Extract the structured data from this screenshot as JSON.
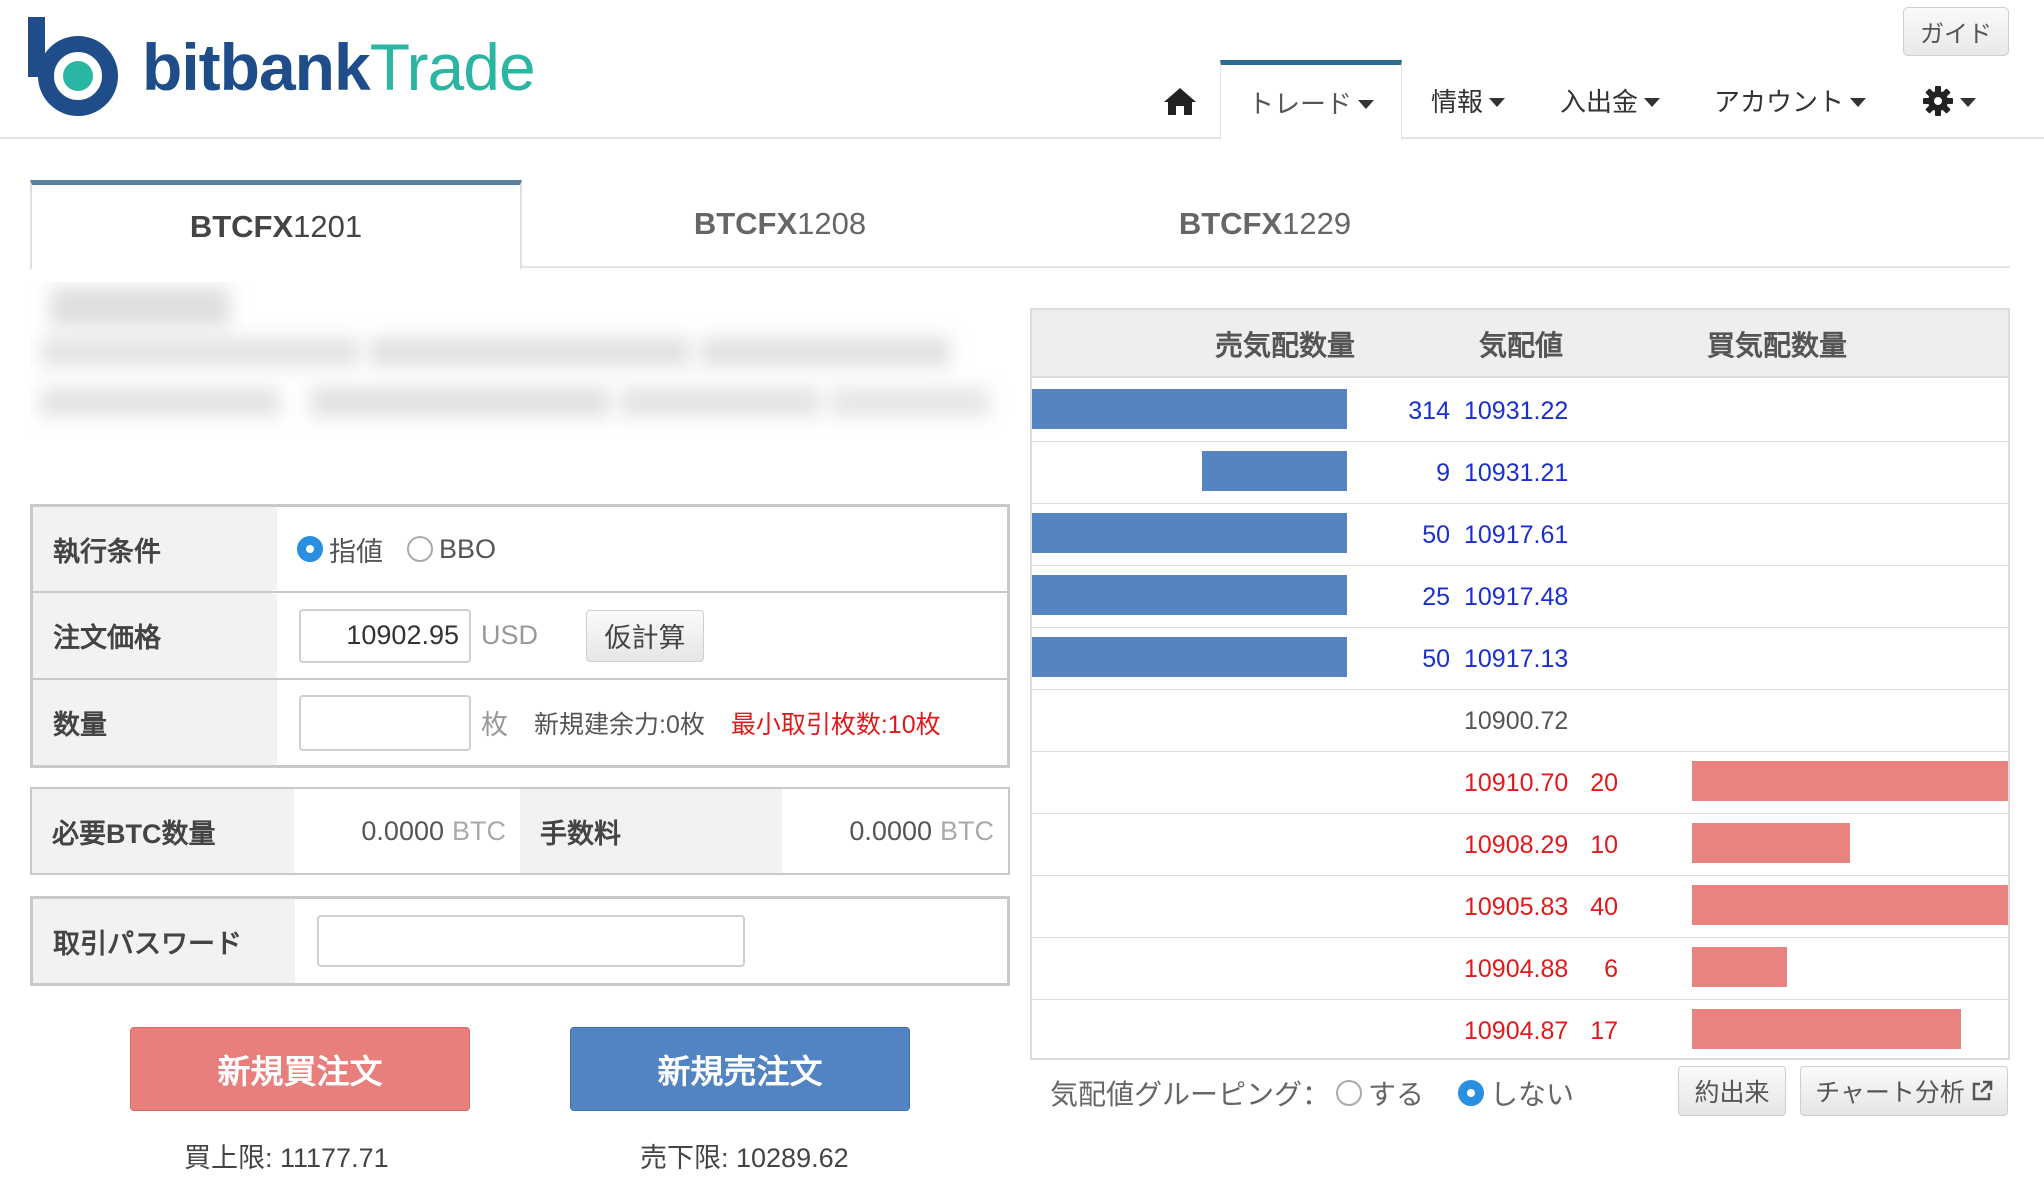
{
  "brand": {
    "name_bold": "bitbank",
    "name_light": "Trade"
  },
  "header": {
    "guide_label": "ガイド",
    "nav": [
      {
        "label": "",
        "icon": "home-icon"
      },
      {
        "label": "トレード"
      },
      {
        "label": "情報"
      },
      {
        "label": "入出金"
      },
      {
        "label": "アカウント"
      },
      {
        "label": "",
        "icon": "gear-icon"
      }
    ],
    "active_nav": "トレード"
  },
  "contracts": [
    {
      "prefix": "BTCFX",
      "code": "1201"
    },
    {
      "prefix": "BTCFX",
      "code": "1208"
    },
    {
      "prefix": "BTCFX",
      "code": "1229"
    }
  ],
  "active_contract": "BTCFX1201",
  "order_form": {
    "exec_label": "執行条件",
    "exec_options": [
      "指値",
      "BBO"
    ],
    "exec_selected": "指値",
    "price_label": "注文価格",
    "price_value": "10902.95",
    "price_unit": "USD",
    "calc_button": "仮計算",
    "qty_label": "数量",
    "qty_value": "",
    "qty_unit": "枚",
    "capacity_text": "新規建余力:0枚",
    "min_text": "最小取引枚数:10枚",
    "min_color": "#e01a1a",
    "btc_label": "必要BTC数量",
    "btc_value": "0.0000",
    "btc_unit": "BTC",
    "fee_label": "手数料",
    "fee_value": "0.0000",
    "fee_unit": "BTC",
    "password_label": "取引パスワード",
    "password_value": "",
    "buy_button": "新規買注文",
    "sell_button": "新規売注文",
    "buy_limit": "買上限: 11177.71",
    "sell_limit": "売下限: 10289.62",
    "buy_color": "#e87f7d",
    "sell_color": "#5284c4"
  },
  "order_book": {
    "headers": {
      "ask_qty": "売気配数量",
      "price": "気配値",
      "bid_qty": "買気配数量"
    },
    "asks": [
      {
        "qty": "314",
        "price": "10931.22",
        "bar_fraction": 1.0
      },
      {
        "qty": "9",
        "price": "10931.21",
        "bar_fraction": 0.46
      },
      {
        "qty": "50",
        "price": "10917.61",
        "bar_fraction": 1.0
      },
      {
        "qty": "25",
        "price": "10917.48",
        "bar_fraction": 1.0
      },
      {
        "qty": "50",
        "price": "10917.13",
        "bar_fraction": 1.0
      }
    ],
    "mid": {
      "price": "10900.72"
    },
    "bids": [
      {
        "price": "10910.70",
        "qty": "20",
        "bar_fraction": 1.0
      },
      {
        "price": "10908.29",
        "qty": "10",
        "bar_fraction": 0.5
      },
      {
        "price": "10905.83",
        "qty": "40",
        "bar_fraction": 1.0
      },
      {
        "price": "10904.88",
        "qty": "6",
        "bar_fraction": 0.3
      },
      {
        "price": "10904.87",
        "qty": "17",
        "bar_fraction": 0.85
      }
    ],
    "ask_color": "#5683c2",
    "bid_color": "#e88380",
    "grouping_label": "気配値グルーピング：",
    "grouping_options": [
      "する",
      "しない"
    ],
    "grouping_selected": "しない",
    "fills_button": "約出来",
    "chart_button": "チャート分析"
  }
}
